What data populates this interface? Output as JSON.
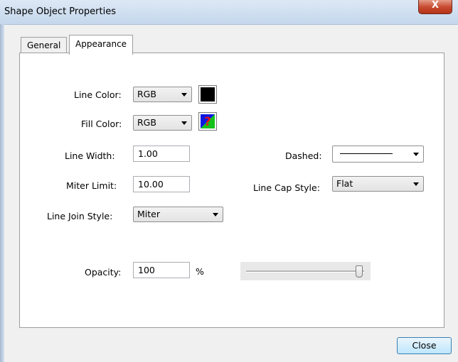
{
  "window": {
    "title": "Shape Object Properties",
    "close_glyph": "X"
  },
  "tabs": [
    {
      "label": "General",
      "active": false
    },
    {
      "label": "Appearance",
      "active": true
    }
  ],
  "appearance": {
    "line_color": {
      "label": "Line Color:",
      "mode": "RGB",
      "swatch_color": "#000000"
    },
    "fill_color": {
      "label": "Fill Color:",
      "mode": "RGB",
      "swatch_icon": "no-fill-question-icon"
    },
    "line_width": {
      "label": "Line Width:",
      "value": "1.00"
    },
    "dashed": {
      "label": "Dashed:"
    },
    "miter_limit": {
      "label": "Miter Limit:",
      "value": "10.00"
    },
    "line_cap_style": {
      "label": "Line Cap Style:",
      "value": "Flat"
    },
    "line_join_style": {
      "label": "Line Join Style:",
      "value": "Miter"
    },
    "opacity": {
      "label": "Opacity:",
      "value": "100",
      "unit": "%",
      "slider_level_percent": 100
    }
  },
  "footer": {
    "close_label": "Close"
  },
  "colors": {
    "button_border": "#3c7fb1",
    "close_x": "#c7492f"
  }
}
